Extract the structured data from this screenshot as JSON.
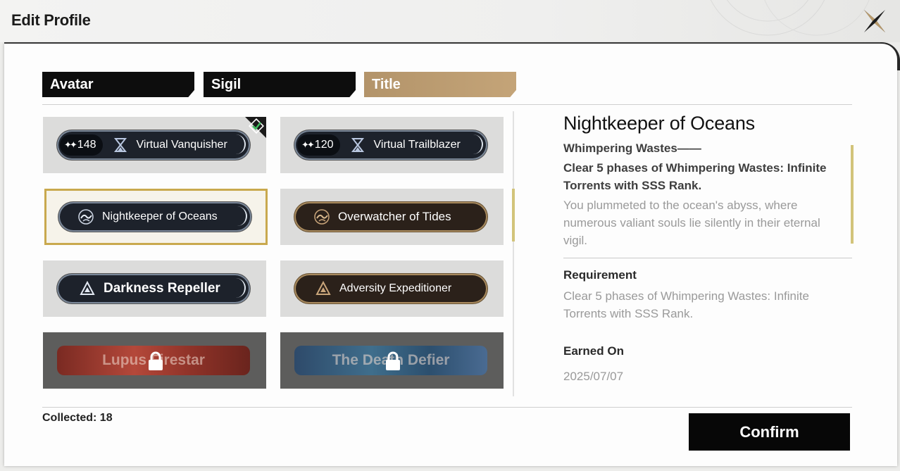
{
  "window": {
    "title": "Edit Profile"
  },
  "tabs": [
    {
      "label": "Avatar",
      "active": false
    },
    {
      "label": "Sigil",
      "active": false
    },
    {
      "label": "Title",
      "active": true
    }
  ],
  "titles": [
    {
      "name": "Virtual Vanquisher",
      "count": "148",
      "style": "dark",
      "equipped": true,
      "icon": "hourglass-icon"
    },
    {
      "name": "Virtual Trailblazer",
      "count": "120",
      "style": "dark",
      "equipped": false,
      "icon": "hourglass-icon"
    },
    {
      "name": "Nightkeeper of Oceans",
      "style": "dark",
      "selected": true,
      "icon": "ocean-emblem-icon"
    },
    {
      "name": "Overwatcher of Tides",
      "style": "brown",
      "icon": "ocean-emblem-icon"
    },
    {
      "name": "Darkness Repeller",
      "style": "dark",
      "icon": "triangle-emblem-icon"
    },
    {
      "name": "Adversity Expeditioner",
      "style": "brown",
      "icon": "triangle-emblem-icon"
    },
    {
      "name": "Lupus Firestar",
      "locked": true
    },
    {
      "name": "The Death Defier",
      "locked": true
    }
  ],
  "detail": {
    "title": "Nightkeeper of Oceans",
    "subtitle": "Whimpering Wastes——",
    "condition": "Clear 5 phases of Whimpering Wastes: Infinite Torrents with SSS Rank.",
    "description": "You plummeted to the ocean's abyss, where numerous valiant souls lie silently in their eternal vigil.",
    "requirement_label": "Requirement",
    "requirement_text": "Clear 5 phases of Whimpering Wastes: Infinite Torrents with SSS Rank.",
    "earned_label": "Earned On",
    "earned_date": "2025/07/07"
  },
  "footer": {
    "collected": "Collected: 18",
    "confirm_label": "Confirm"
  },
  "colors": {
    "accent_gold": "#c4a478",
    "selected_border": "#c9a94e",
    "equipped_check": "#3fbf5f"
  }
}
